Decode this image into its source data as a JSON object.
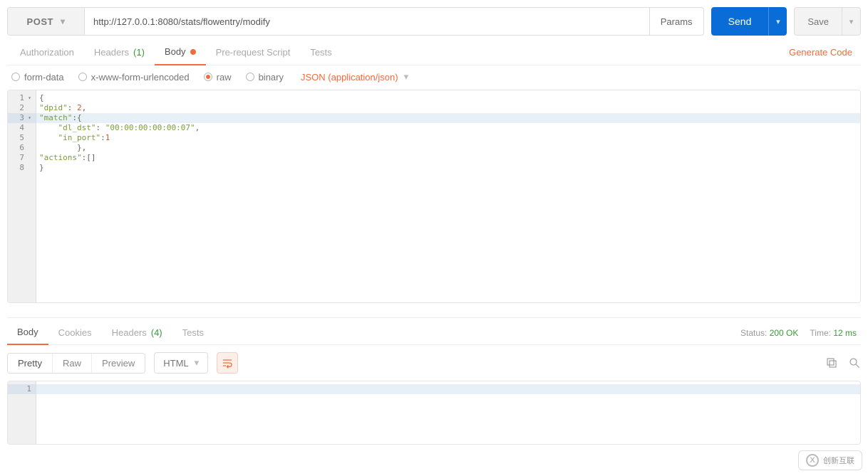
{
  "request": {
    "method": "POST",
    "url": "http://127.0.0.1:8080/stats/flowentry/modify",
    "params_label": "Params",
    "send_label": "Send",
    "save_label": "Save"
  },
  "req_tabs": {
    "authorization": "Authorization",
    "headers_label": "Headers",
    "headers_count": "(1)",
    "body": "Body",
    "prerequest": "Pre-request Script",
    "tests": "Tests",
    "generate_code": "Generate Code"
  },
  "body_types": {
    "formdata": "form-data",
    "xwww": "x-www-form-urlencoded",
    "raw": "raw",
    "binary": "binary",
    "content_type": "JSON (application/json)"
  },
  "editor": {
    "active_line_index": 2,
    "lines": [
      [
        {
          "t": "punc",
          "v": "{"
        }
      ],
      [
        {
          "t": "key",
          "v": "\"dpid\""
        },
        {
          "t": "punc",
          "v": ": "
        },
        {
          "t": "num",
          "v": "2"
        },
        {
          "t": "punc",
          "v": ","
        }
      ],
      [
        {
          "t": "key",
          "v": "\"match\""
        },
        {
          "t": "punc",
          "v": ":{"
        }
      ],
      [
        {
          "t": "pad",
          "v": "    "
        },
        {
          "t": "key",
          "v": "\"dl_dst\""
        },
        {
          "t": "punc",
          "v": ": "
        },
        {
          "t": "str",
          "v": "\"00:00:00:00:00:07\""
        },
        {
          "t": "punc",
          "v": ","
        }
      ],
      [
        {
          "t": "pad",
          "v": "    "
        },
        {
          "t": "key",
          "v": "\"in_port\""
        },
        {
          "t": "punc",
          "v": ":"
        },
        {
          "t": "num",
          "v": "1"
        }
      ],
      [
        {
          "t": "pad",
          "v": "        "
        },
        {
          "t": "punc",
          "v": "},"
        }
      ],
      [
        {
          "t": "key",
          "v": "\"actions\""
        },
        {
          "t": "punc",
          "v": ":[]"
        }
      ],
      [
        {
          "t": "punc",
          "v": "}"
        }
      ]
    ],
    "fold_lines": [
      0,
      2
    ]
  },
  "response": {
    "tabs": {
      "body": "Body",
      "cookies": "Cookies",
      "headers_label": "Headers",
      "headers_count": "(4)",
      "tests": "Tests"
    },
    "status_label": "Status:",
    "status_value": "200 OK",
    "time_label": "Time:",
    "time_value": "12 ms",
    "view_modes": {
      "pretty": "Pretty",
      "raw": "Raw",
      "preview": "Preview"
    },
    "lang": "HTML",
    "lines_count": 1
  },
  "watermark": {
    "brand": "创新互联"
  }
}
